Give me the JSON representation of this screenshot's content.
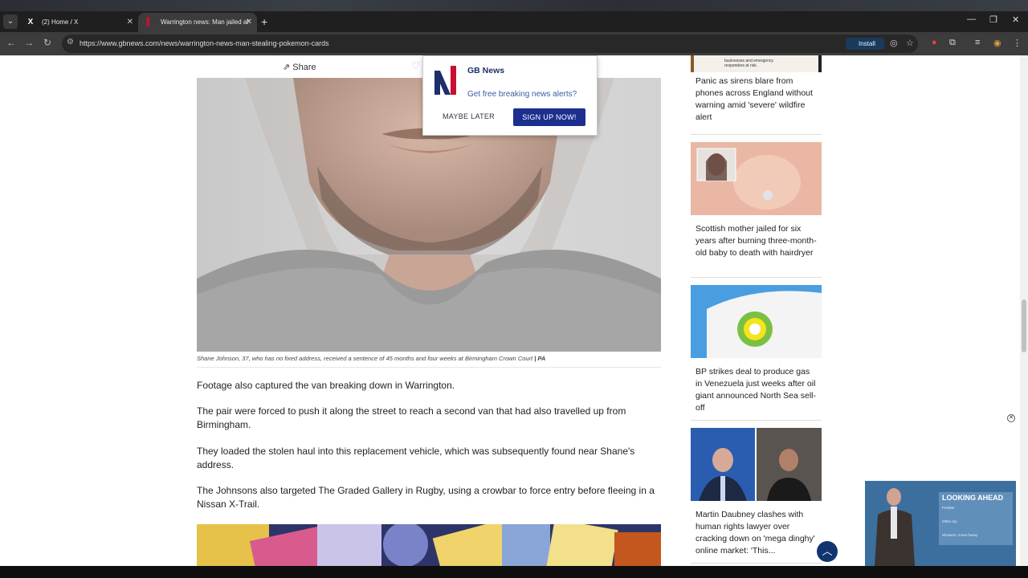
{
  "browser": {
    "tabs": [
      {
        "title": "(2) Home / X",
        "icon": "x-logo"
      },
      {
        "title": "Warrington news: Man jailed af",
        "icon": "gbnews-logo"
      }
    ],
    "url": "https://www.gbnews.com/news/warrington-news-man-stealing-pokemon-cards",
    "install_label": "Install"
  },
  "article": {
    "share_label": "Share",
    "caption": "Shane Johnson, 37, who has no fixed address, received a sentence of 45 months and four weeks at Birmingham Crown Court",
    "caption_credit": "| PA",
    "paragraphs": [
      "Footage also captured the van breaking down in Warrington.",
      "The pair were forced to push it along the street to reach a second van that had also travelled up from Birmingham.",
      "They loaded the stolen haul into this replacement vehicle, which was subsequently found near Shane's address.",
      "The Johnsons also targeted The Graded Gallery in Rugby, using a crowbar to force entry before fleeing in a Nissan X-Trail."
    ]
  },
  "sidebar": {
    "top_thumb_text": "businesses and emergency responders at risk.",
    "items": [
      {
        "title": "Panic as sirens blare from phones across England without warning amid 'severe' wildfire alert"
      },
      {
        "title": "Scottish mother jailed for six years after burning three-month-old baby to death with hairdryer"
      },
      {
        "title": "BP strikes deal to produce gas in Venezuela just weeks after oil giant announced North Sea sell-off"
      },
      {
        "title": "Martin Daubney clashes with human rights lawyer over cracking down on 'mega dinghy' online market: 'This..."
      }
    ]
  },
  "popup": {
    "brand": "GB News",
    "message": "Get free breaking news alerts?",
    "later_label": "MAYBE LATER",
    "signup_label": "SIGN UP NOW!"
  },
  "video": {
    "heading": "LOOKING AHEAD",
    "rows": [
      "Fresher",
      "Often dry",
      "Showers, some heavy"
    ]
  },
  "colors": {
    "brand_navy": "#1c2f8f",
    "popup_link": "#3b5ba0",
    "scroll_top_button": "#10356f"
  }
}
